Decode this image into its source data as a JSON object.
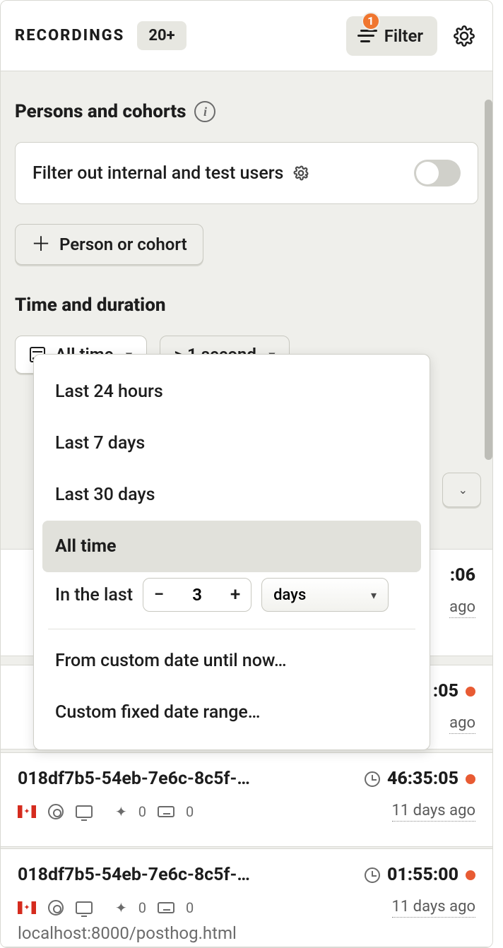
{
  "header": {
    "title": "RECORDINGS",
    "count_badge": "20+",
    "filter_label": "Filter",
    "filter_badge": "1"
  },
  "persons": {
    "title": "Persons and cohorts",
    "card_label": "Filter out internal and test users",
    "add_button": "Person or cohort"
  },
  "time": {
    "title": "Time and duration",
    "date_select": "All time",
    "duration_select": "> 1 second"
  },
  "date_popover": {
    "options": [
      "Last 24 hours",
      "Last 7 days",
      "Last 30 days",
      "All time"
    ],
    "selected_index": 3,
    "in_the_last_label": "In the last",
    "in_the_last_value": "3",
    "in_the_last_unit": "days",
    "extra": [
      "From custom date until now…",
      "Custom fixed date range…"
    ]
  },
  "rows": [
    {
      "id": "",
      "duration_partial": ":06",
      "ago": "ago",
      "live": false
    },
    {
      "id": "",
      "duration_partial": ":05",
      "ago": "ago",
      "live": true
    },
    {
      "id": "018df7b5-54eb-7e6c-8c5f-…",
      "duration": "46:35:05",
      "click_count": "0",
      "key_count": "0",
      "ago": "11 days ago",
      "live": true
    },
    {
      "id": "018df7b5-54eb-7e6c-8c5f-…",
      "duration": "01:55:00",
      "click_count": "0",
      "key_count": "0",
      "ago": "11 days ago",
      "live": true
    }
  ],
  "footer_url": "localhost:8000/posthog.html"
}
